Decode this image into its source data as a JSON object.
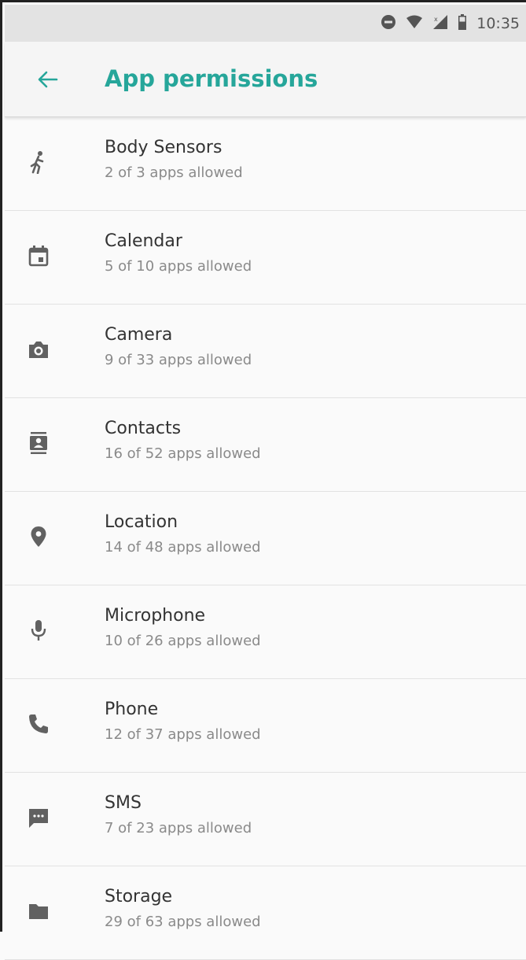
{
  "status_bar": {
    "time": "10:35",
    "icons": [
      "do-not-disturb-icon",
      "wifi-icon",
      "signal-icon",
      "battery-icon"
    ]
  },
  "app_bar": {
    "title": "App permissions",
    "back_icon": "arrow-back-icon",
    "accent_color": "#26a69a"
  },
  "permissions": [
    {
      "icon": "body-sensors-icon",
      "title": "Body Sensors",
      "subtitle": "2 of 3 apps allowed"
    },
    {
      "icon": "calendar-icon",
      "title": "Calendar",
      "subtitle": "5 of 10 apps allowed"
    },
    {
      "icon": "camera-icon",
      "title": "Camera",
      "subtitle": "9 of 33 apps allowed"
    },
    {
      "icon": "contacts-icon",
      "title": "Contacts",
      "subtitle": "16 of 52 apps allowed"
    },
    {
      "icon": "location-icon",
      "title": "Location",
      "subtitle": "14 of 48 apps allowed"
    },
    {
      "icon": "microphone-icon",
      "title": "Microphone",
      "subtitle": "10 of 26 apps allowed"
    },
    {
      "icon": "phone-icon",
      "title": "Phone",
      "subtitle": "12 of 37 apps allowed"
    },
    {
      "icon": "sms-icon",
      "title": "SMS",
      "subtitle": "7 of 23 apps allowed"
    },
    {
      "icon": "storage-icon",
      "title": "Storage",
      "subtitle": "29 of 63 apps allowed"
    }
  ]
}
